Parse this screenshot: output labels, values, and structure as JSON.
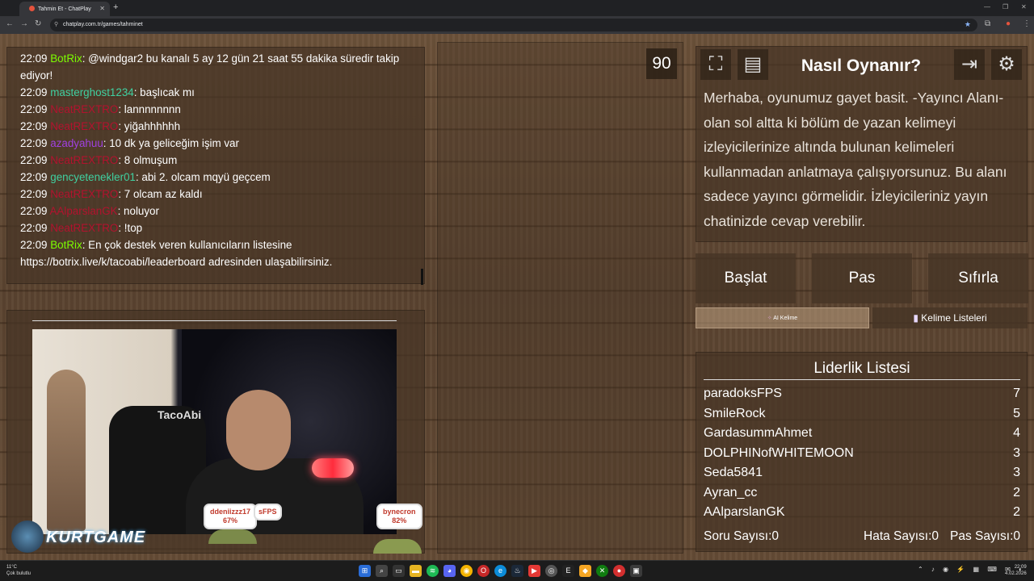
{
  "browser": {
    "tab_title": "Tahmin Et - ChatPlay",
    "url": "chatplay.com.tr/games/tahminet"
  },
  "chat": {
    "messages": [
      {
        "time": "22:09",
        "user": "BotRix",
        "color": "#7cfc00",
        "text": ": @windgar2 bu kanalı 5 ay 12 gün 21 saat 55 dakika süredir takip ediyor!"
      },
      {
        "time": "22:09",
        "user": "masterghost1234",
        "color": "#3fd0a0",
        "text": ": başlıcak mı"
      },
      {
        "time": "22:09",
        "user": "NeatREXTRO",
        "color": "#b3122e",
        "text": ": lannnnnnnn"
      },
      {
        "time": "22:09",
        "user": "NeatREXTRO",
        "color": "#b3122e",
        "text": ": yiğahhhhhh"
      },
      {
        "time": "22:09",
        "user": "azadyahuu",
        "color": "#a040e0",
        "text": ": 10 dk ya geliceğim işim var"
      },
      {
        "time": "22:09",
        "user": "NeatREXTRO",
        "color": "#b3122e",
        "text": ": 8 olmuşum"
      },
      {
        "time": "22:09",
        "user": "gencyetenekler01",
        "color": "#3fd0a0",
        "text": ": abi 2. olcam mqyü geçcem"
      },
      {
        "time": "22:09",
        "user": "NeatREXTRO",
        "color": "#b3122e",
        "text": ": 7 olcam az kaldı"
      },
      {
        "time": "22:09",
        "user": "AAlparslanGK",
        "color": "#b3122e",
        "text": ": noluyor"
      },
      {
        "time": "22:09",
        "user": "NeatREXTRO",
        "color": "#b3122e",
        "text": ": !top"
      },
      {
        "time": "22:09",
        "user": "BotRix",
        "color": "#7cfc00",
        "text": ": En çok destek veren kullanıcıların listesine https://botrix.live/k/tacoabi/leaderboard adresinden ulaşabilirsiniz."
      }
    ]
  },
  "webcam": {
    "chair_text": "TacoAbi",
    "badges": [
      {
        "name": "ddeniizzz17",
        "pct": "67%"
      },
      {
        "name": "sFPS",
        "pct": ""
      },
      {
        "name": "bynecron",
        "pct": "82%"
      }
    ],
    "logo_text": "KURTGAME"
  },
  "game": {
    "timer": "90"
  },
  "howto": {
    "title": "Nasıl Oynanır?",
    "text": "Merhaba, oyunumuz gayet basit. -Yayıncı Alanı- olan sol altta ki bölüm de yazan kelimeyi izleyicilerinize altında bulunan kelimeleri kullanmadan anlatmaya çalışıyorsunuz. Bu alanı sadece yayıncı görmelidir. İzleyicileriniz yayın chatinizde cevap verebilir."
  },
  "controls": {
    "start": "Başlat",
    "pass": "Pas",
    "reset": "Sıfırla",
    "ai_word": "AI Kelime",
    "word_lists": "Kelime Listeleri"
  },
  "leaderboard": {
    "title": "Liderlik Listesi",
    "rows": [
      {
        "name": "paradoksFPS",
        "score": "7"
      },
      {
        "name": "SmileRock",
        "score": "5"
      },
      {
        "name": "GardasummAhmet",
        "score": "4"
      },
      {
        "name": "DOLPHINofWHITEMOON",
        "score": "3"
      },
      {
        "name": "Seda5841",
        "score": "3"
      },
      {
        "name": "Ayran_cc",
        "score": "2"
      },
      {
        "name": "AAlparslanGK",
        "score": "2"
      }
    ],
    "question_count": "Soru Sayısı:0",
    "error_count": "Hata Sayısı:0",
    "pass_count": "Pas Sayısı:0"
  },
  "taskbar": {
    "temp": "11°C",
    "weather": "Çok bulutlu",
    "time": "22:09",
    "date": "4.02.2026"
  }
}
